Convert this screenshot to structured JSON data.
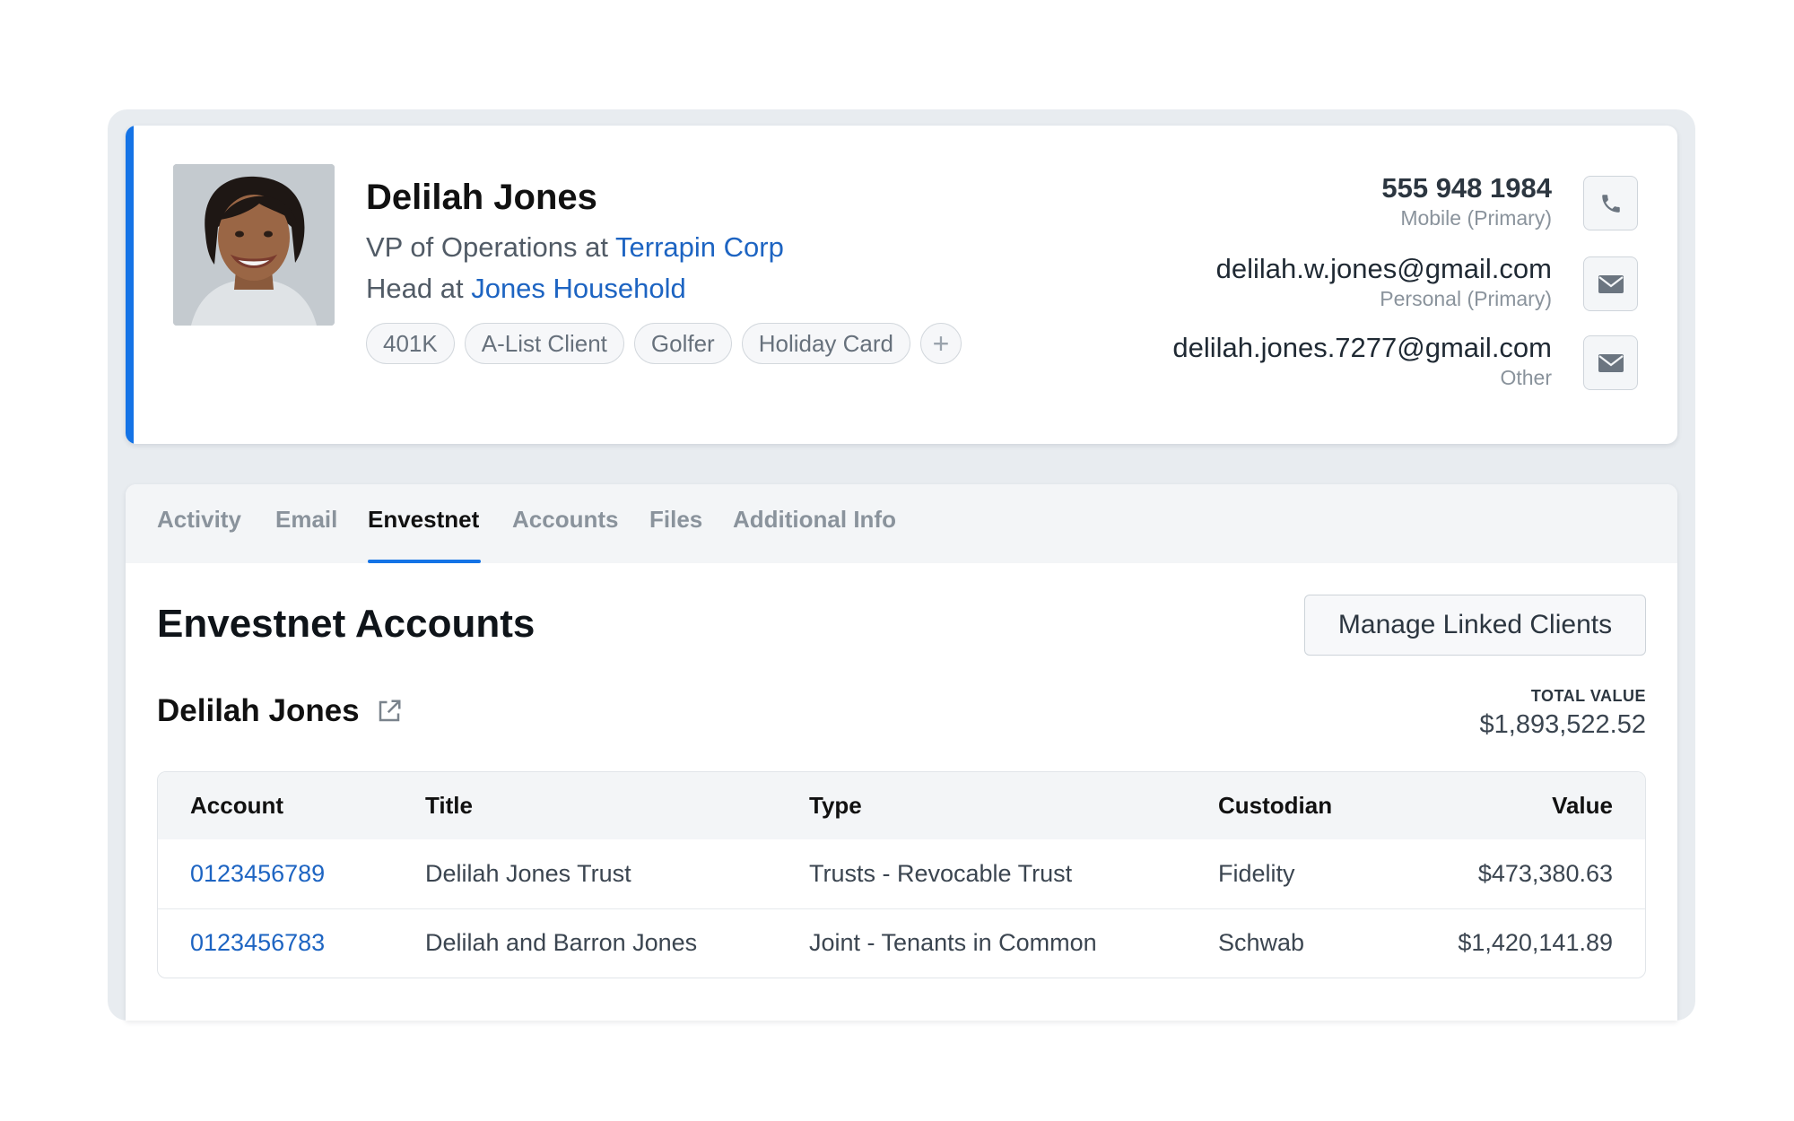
{
  "contact": {
    "name": "Delilah Jones",
    "role1_prefix": "VP of Operations at ",
    "role1_link": "Terrapin Corp",
    "role2_prefix": "Head at ",
    "role2_link": "Jones Household",
    "tags": [
      "401K",
      "A-List Client",
      "Golfer",
      "Holiday Card"
    ],
    "add_tag_symbol": "+",
    "phone": {
      "value": "555 948 1984",
      "label": "Mobile (Primary)",
      "icon": "phone-icon"
    },
    "email_primary": {
      "value": "delilah.w.jones@gmail.com",
      "label": "Personal (Primary)",
      "icon": "mail-icon"
    },
    "email_other": {
      "value": "delilah.jones.7277@gmail.com",
      "label": "Other",
      "icon": "mail-icon"
    }
  },
  "tabs": [
    {
      "label": "Activity",
      "active": false
    },
    {
      "label": "Email",
      "active": false
    },
    {
      "label": "Envestnet",
      "active": true
    },
    {
      "label": "Accounts",
      "active": false
    },
    {
      "label": "Files",
      "active": false
    },
    {
      "label": "Additional Info",
      "active": false
    }
  ],
  "envestnet": {
    "title": "Envestnet Accounts",
    "manage_button": "Manage Linked Clients",
    "client_name": "Delilah Jones",
    "total_label": "TOTAL VALUE",
    "total_value": "$1,893,522.52",
    "columns": [
      "Account",
      "Title",
      "Type",
      "Custodian",
      "Value"
    ],
    "rows": [
      {
        "account": "0123456789",
        "title": "Delilah Jones Trust",
        "type": "Trusts - Revocable Trust",
        "custodian": "Fidelity",
        "value": "$473,380.63"
      },
      {
        "account": "0123456783",
        "title": "Delilah and Barron Jones",
        "type": "Joint - Tenants in Common",
        "custodian": "Schwab",
        "value": "$1,420,141.89"
      }
    ]
  },
  "colors": {
    "accent": "#1473e6",
    "link": "#1d64c2",
    "background_frame": "#e8ecf0"
  }
}
